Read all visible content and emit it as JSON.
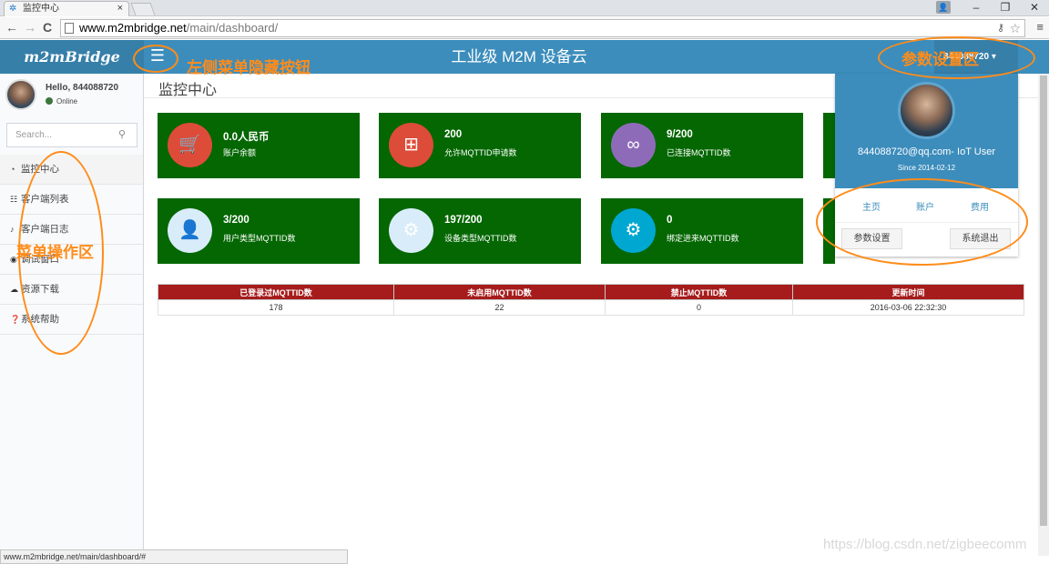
{
  "browser": {
    "tab_title": "监控中心",
    "tab_close": "×",
    "url_domain": "www.m2mbridge.net",
    "url_path": "/main/dashboard/",
    "status_url": "www.m2mbridge.net/main/dashboard/#",
    "back_icon": "←",
    "forward_icon": "→",
    "reload_icon": "C",
    "menu_icon": "≡"
  },
  "header": {
    "logo": "m2mBridge",
    "title": "工业级 M2M 设备云",
    "user_label": "844088720 ▾",
    "brand_color": "#3c8dbc"
  },
  "annotations": {
    "menu_toggle": "左侧菜单隐藏按钮",
    "params": "参数设置区",
    "menu_area": "菜单操作区",
    "color": "#ff8c1a"
  },
  "sidebar": {
    "greeting": "Hello, 844088720",
    "status": "Online",
    "search_placeholder": "Search...",
    "items": [
      {
        "label": "监控中心",
        "icon": "dashboard-icon"
      },
      {
        "label": "客户端列表",
        "icon": "list-icon"
      },
      {
        "label": "客户端日志",
        "icon": "bell-icon"
      },
      {
        "label": "调试窗口",
        "icon": "eye-icon"
      },
      {
        "label": "资源下载",
        "icon": "cloud-download-icon"
      },
      {
        "label": "系统帮助",
        "icon": "question-icon"
      }
    ]
  },
  "main": {
    "page_title": "监控中心",
    "boxes": [
      {
        "value": "0.0人民币",
        "label": "账户余额",
        "icon": "cart-icon",
        "color": "#dd4b39"
      },
      {
        "value": "200",
        "label": "允许MQTTID申请数",
        "icon": "sitemap-icon",
        "color": "#dd4b39"
      },
      {
        "value": "9/200",
        "label": "已连接MQTTID数",
        "icon": "link-icon",
        "color": "#8e6bb8"
      },
      {
        "value": "3/200",
        "label": "用户类型MQTTID数",
        "icon": "user-icon",
        "color": "#d9ecf9"
      },
      {
        "value": "197/200",
        "label": "设备类型MQTTID数",
        "icon": "gear-icon",
        "color": "#d9ecf9"
      },
      {
        "value": "0",
        "label": "绑定进来MQTTID数",
        "icon": "gears-icon",
        "color": "#00a7d0"
      }
    ],
    "table": {
      "headers": [
        "已登录过MQTTID数",
        "未启用MQTTID数",
        "禁止MQTTID数",
        "更新时间"
      ],
      "row": [
        "178",
        "22",
        "0",
        "2016-03-06 22:32:30"
      ]
    }
  },
  "dropdown": {
    "email": "844088720@qq.com- IoT User",
    "since": "Since 2014-02-12",
    "links": [
      "主页",
      "账户",
      "费用"
    ],
    "settings_button": "参数设置",
    "logout_button": "系统退出"
  },
  "watermark": "https://blog.csdn.net/zigbeecomm"
}
